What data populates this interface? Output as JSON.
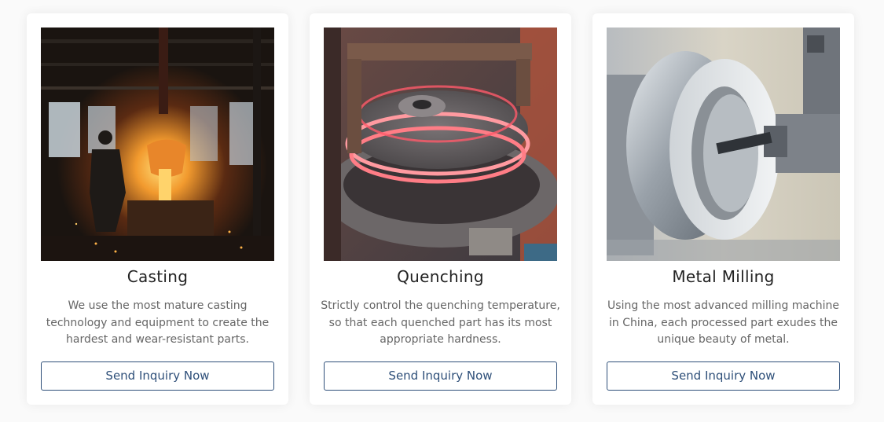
{
  "cards": [
    {
      "title": "Casting",
      "description": "We use the most mature casting technology and equipment to create the hardest and wear-resistant parts.",
      "button_label": "Send Inquiry Now",
      "image_subject": "foundry-pouring-molten-metal"
    },
    {
      "title": "Quenching",
      "description": "Strictly control the quenching temperature, so that each quenched part has its most appropriate hardness.",
      "button_label": "Send Inquiry Now",
      "image_subject": "induction-quenching-glowing-part"
    },
    {
      "title": "Metal Milling",
      "description": "Using the most advanced milling machine in China, each processed part exudes the unique beauty of metal.",
      "button_label": "Send Inquiry Now",
      "image_subject": "lathe-machining-metal-ring"
    }
  ],
  "colors": {
    "accent": "#2e4f79",
    "title_text": "#222222",
    "body_text": "#666666",
    "card_background": "#ffffff",
    "page_background": "#fafafa"
  }
}
